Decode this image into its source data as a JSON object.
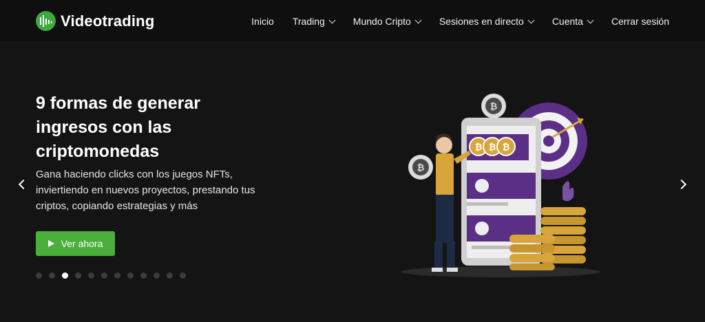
{
  "brand": {
    "name": "Videotrading",
    "accent": "#4cae3d"
  },
  "nav": {
    "items": [
      {
        "label": "Inicio",
        "has_dropdown": false
      },
      {
        "label": "Trading",
        "has_dropdown": true
      },
      {
        "label": "Mundo Cripto",
        "has_dropdown": true
      },
      {
        "label": "Sesiones en directo",
        "has_dropdown": true
      },
      {
        "label": "Cuenta",
        "has_dropdown": true
      },
      {
        "label": "Cerrar sesión",
        "has_dropdown": false
      }
    ]
  },
  "hero": {
    "title": "9 formas de generar ingresos con las criptomonedas",
    "subtitle": "Gana haciendo clicks con los juegos NFTs, inviertiendo en nuevos proyectos, prestando tus criptos, copiando estrategias y más",
    "cta_label": "Ver ahora",
    "slide_count": 12,
    "active_slide": 3
  },
  "colors": {
    "background": "#141414",
    "navbar": "#0f0f0f",
    "purple": "#5b2f86",
    "gold": "#d7a53a"
  }
}
